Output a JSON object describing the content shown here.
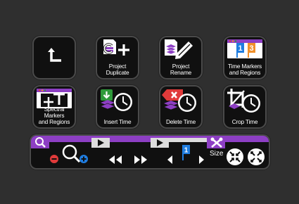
{
  "tiles": [
    {
      "id": "back",
      "label": "",
      "icon": "return-arrow-icon"
    },
    {
      "id": "project-duplicate",
      "label": "Project\nDuplicate",
      "icon": "duplicate-icon"
    },
    {
      "id": "project-rename",
      "label": "Project\nRename",
      "icon": "rename-pencil-icon"
    },
    {
      "id": "time-markers",
      "label": "Time Markers\nand Regions",
      "icon": "time-markers-icon",
      "marker_numbers": [
        "1",
        "3"
      ]
    },
    {
      "id": "spectral-markers",
      "label": "Spectral Markers\nand Regions",
      "icon": "spectral-markers-icon"
    },
    {
      "id": "insert-time",
      "label": "Insert Time",
      "icon": "insert-time-icon"
    },
    {
      "id": "delete-time",
      "label": "Delete Time",
      "icon": "delete-time-icon"
    },
    {
      "id": "crop-time",
      "label": "Crop Time",
      "icon": "crop-time-icon"
    }
  ],
  "toolbar": {
    "size_label": "Size",
    "marker_number": "1",
    "icons": [
      "search-icon",
      "zoom-out-icon",
      "zoom-icon",
      "zoom-in-icon",
      "play-icon",
      "rewind-icon",
      "fast-forward-icon",
      "previous-marker-icon",
      "marker-flag-icon",
      "next-marker-icon",
      "tools-icon",
      "zoom-fit-icon",
      "zoom-expand-icon"
    ]
  },
  "colors": {
    "background": "#2f2f2f",
    "tile": "#101010",
    "purple": "#8d3fc4",
    "blue": "#1f7de0",
    "red": "#e03a3a",
    "green": "#2e9a3a",
    "orange": "#f0902a"
  }
}
